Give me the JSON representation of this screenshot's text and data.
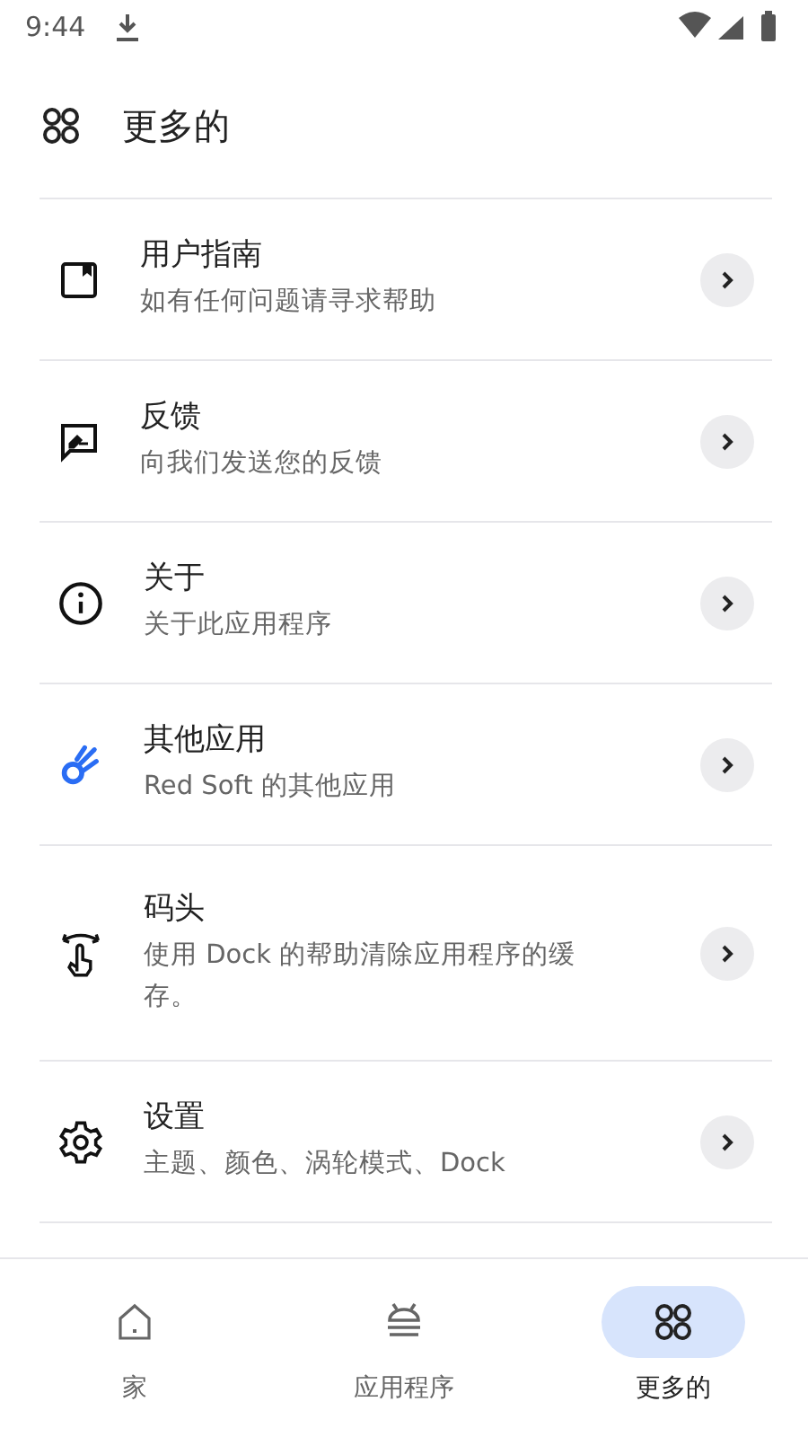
{
  "status_bar": {
    "time": "9:44"
  },
  "header": {
    "title": "更多的"
  },
  "items": [
    {
      "title": "用户指南",
      "subtitle": "如有任何问题请寻求帮助"
    },
    {
      "title": "反馈",
      "subtitle": "向我们发送您的反馈"
    },
    {
      "title": "关于",
      "subtitle": "关于此应用程序"
    },
    {
      "title": "其他应用",
      "subtitle": "Red Soft 的其他应用"
    },
    {
      "title": "码头",
      "subtitle": "使用 Dock 的帮助清除应用程序的缓存。"
    },
    {
      "title": "设置",
      "subtitle": "主题、颜色、涡轮模式、Dock"
    }
  ],
  "nav": [
    {
      "label": "家",
      "selected": false
    },
    {
      "label": "应用程序",
      "selected": false
    },
    {
      "label": "更多的",
      "selected": true
    }
  ]
}
